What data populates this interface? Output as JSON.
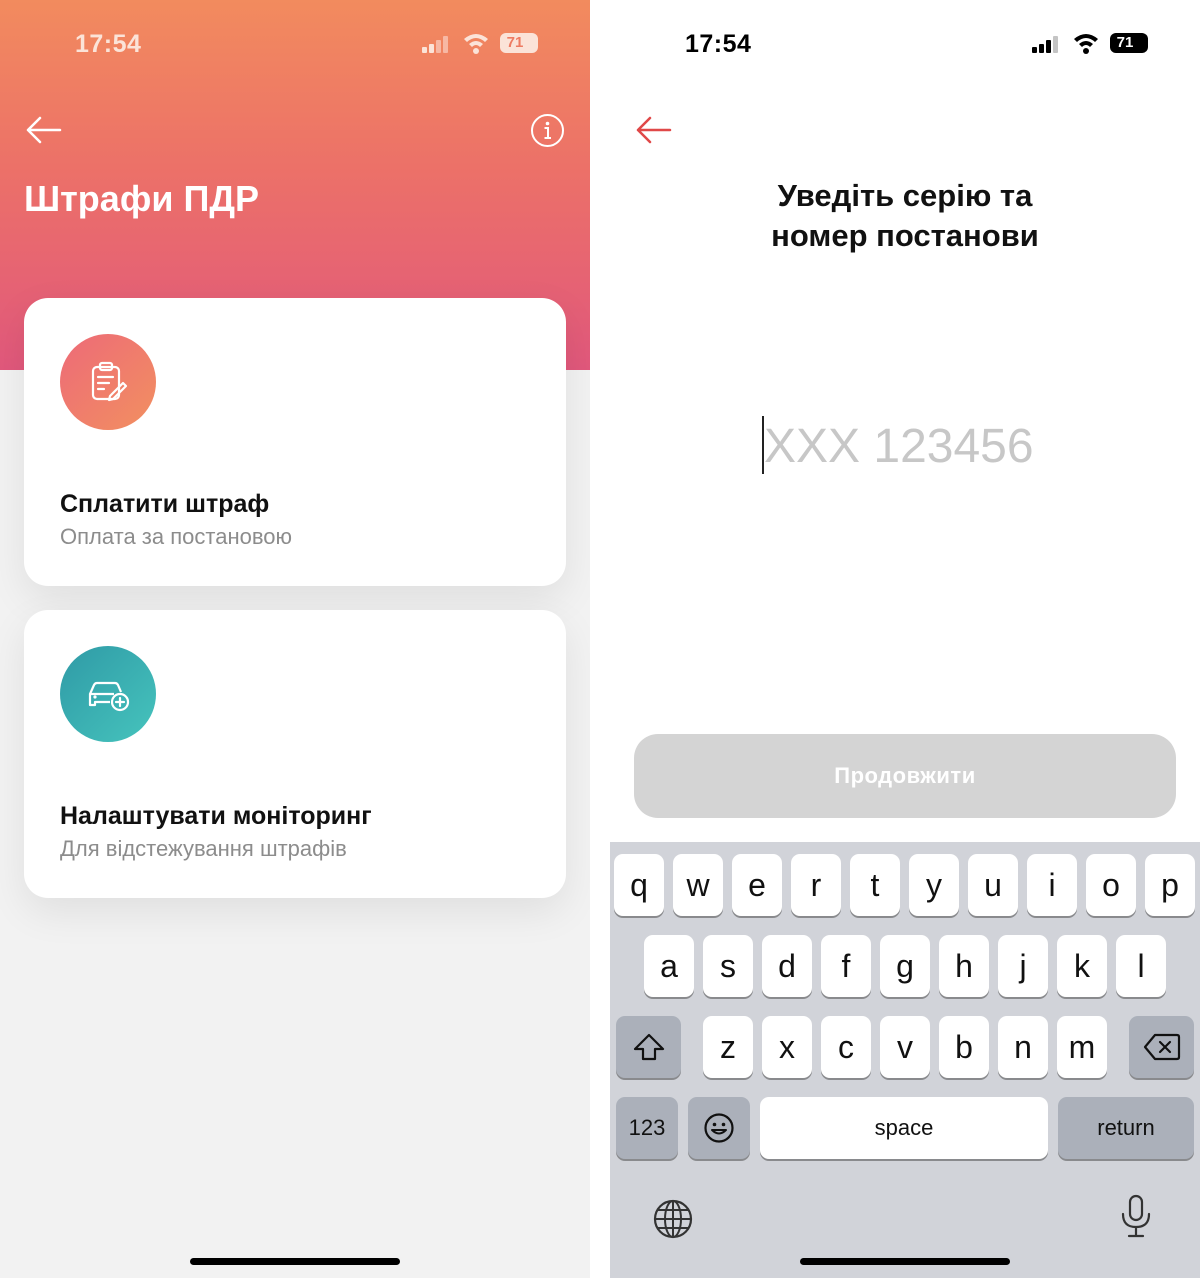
{
  "status_bar": {
    "time": "17:54",
    "battery": "71"
  },
  "left": {
    "title": "Штрафи ПДР",
    "cards": [
      {
        "title": "Сплатити штраф",
        "subtitle": "Оплата за постановою",
        "icon": "clipboard-edit-icon",
        "color": "#ee7568"
      },
      {
        "title": "Налаштувати моніторинг",
        "subtitle": "Для відстежування штрафів",
        "icon": "car-add-icon",
        "color": "#3bb1b0"
      }
    ]
  },
  "right": {
    "title_line1": "Уведіть серію та",
    "title_line2": "номер постанови",
    "input_placeholder": "XXX 123456",
    "continue_label": "Продовжити"
  },
  "keyboard": {
    "row1": [
      "q",
      "w",
      "e",
      "r",
      "t",
      "y",
      "u",
      "i",
      "o",
      "p"
    ],
    "row2": [
      "a",
      "s",
      "d",
      "f",
      "g",
      "h",
      "j",
      "k",
      "l"
    ],
    "row3": [
      "z",
      "x",
      "c",
      "v",
      "b",
      "n",
      "m"
    ],
    "numbers_label": "123",
    "space_label": "space",
    "return_label": "return"
  },
  "colors": {
    "header_top": "#f28b5e",
    "header_bottom": "#e1587c",
    "accent_red": "#e04848",
    "disabled_button": "#d4d4d4"
  }
}
